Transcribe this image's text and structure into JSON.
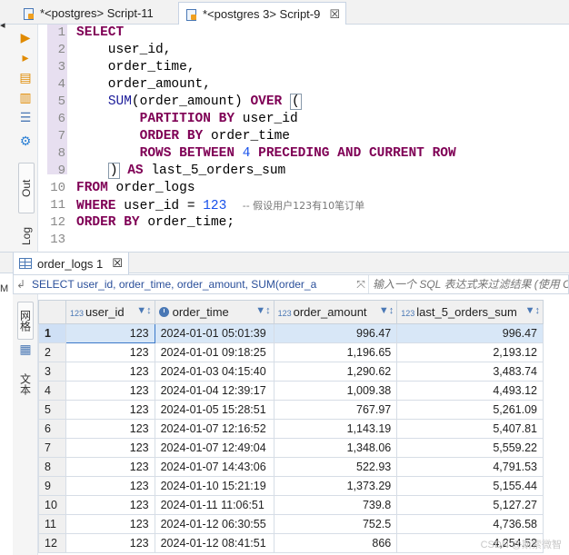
{
  "tabs": [
    {
      "label": "*<postgres> Script-11",
      "active": false
    },
    {
      "label": "*<postgres 3> Script-9",
      "active": true,
      "close": "☒"
    }
  ],
  "left_toolbar": {
    "out_label": "Out",
    "log_label": "Log",
    "edge_mark": "M"
  },
  "editor": {
    "line_numbers": [
      "1",
      "2",
      "3",
      "4",
      "5",
      "6",
      "7",
      "8",
      "9",
      "10",
      "11",
      "12",
      "13"
    ],
    "comment": "-- 假设用户123有10笔订单"
  },
  "results": {
    "tab_label": "order_logs 1",
    "tab_close": "☒",
    "filter_query": "SELECT user_id, order_time, order_amount, SUM(order_a",
    "filter_placeholder": "输入一个 SQL 表达式来过滤结果 (使用 Ct",
    "side_grid_label": "网格",
    "side_text_label": "文本",
    "columns": [
      {
        "name": "user_id",
        "type": "123"
      },
      {
        "name": "order_time",
        "type": "clock"
      },
      {
        "name": "order_amount",
        "type": "123"
      },
      {
        "name": "last_5_orders_sum",
        "type": "123"
      }
    ],
    "rows": [
      [
        "1",
        "123",
        "2024-01-01 05:01:39",
        "996.47",
        "996.47"
      ],
      [
        "2",
        "123",
        "2024-01-01 09:18:25",
        "1,196.65",
        "2,193.12"
      ],
      [
        "3",
        "123",
        "2024-01-03 04:15:40",
        "1,290.62",
        "3,483.74"
      ],
      [
        "4",
        "123",
        "2024-01-04 12:39:17",
        "1,009.38",
        "4,493.12"
      ],
      [
        "5",
        "123",
        "2024-01-05 15:28:51",
        "767.97",
        "5,261.09"
      ],
      [
        "6",
        "123",
        "2024-01-07 12:16:52",
        "1,143.19",
        "5,407.81"
      ],
      [
        "7",
        "123",
        "2024-01-07 12:49:04",
        "1,348.06",
        "5,559.22"
      ],
      [
        "8",
        "123",
        "2024-01-07 14:43:06",
        "522.93",
        "4,791.53"
      ],
      [
        "9",
        "123",
        "2024-01-10 15:21:19",
        "1,373.29",
        "5,155.44"
      ],
      [
        "10",
        "123",
        "2024-01-11 11:06:51",
        "739.8",
        "5,127.27"
      ],
      [
        "11",
        "123",
        "2024-01-12 06:30:55",
        "752.5",
        "4,736.58"
      ],
      [
        "12",
        "123",
        "2024-01-12 08:41:51",
        "866",
        "4,254.52"
      ]
    ]
  },
  "watermark": "CSDN @斯索微智"
}
